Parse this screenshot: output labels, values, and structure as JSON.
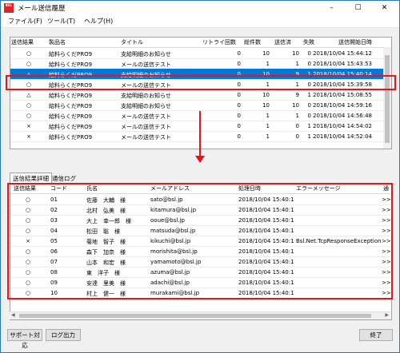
{
  "window": {
    "title": "メール送信履歴",
    "icon_text": "BSL"
  },
  "menu": [
    {
      "label": "ファイル(F)"
    },
    {
      "label": "ツール(T)"
    },
    {
      "label": "ヘルプ(H)"
    }
  ],
  "top_grid": {
    "columns": [
      "送信結果",
      "製品名",
      "タイトル",
      "リトライ回数",
      "総件数",
      "送信済",
      "失敗",
      "送信開始日時"
    ],
    "rows": [
      {
        "result": "○",
        "product": "給料らくだPRO9",
        "title": "支給明細のお知らせ",
        "retry": "0",
        "total": "10",
        "sent": "10",
        "fail": "0",
        "start": "2018/10/04 15:44:12"
      },
      {
        "result": "○",
        "product": "給料らくだPRO9",
        "title": "メールの送信テスト",
        "retry": "0",
        "total": "1",
        "sent": "1",
        "fail": "0",
        "start": "2018/10/04 15:43:53"
      },
      {
        "result": "△",
        "product": "給料らくだPRO9",
        "title": "支給明細のお知らせ",
        "retry": "0",
        "total": "10",
        "sent": "9",
        "fail": "1",
        "start": "2018/10/04 15:40:14",
        "selected": true
      },
      {
        "result": "○",
        "product": "給料らくだPRO9",
        "title": "メールの送信テスト",
        "retry": "0",
        "total": "1",
        "sent": "1",
        "fail": "0",
        "start": "2018/10/04 15:39:58"
      },
      {
        "result": "△",
        "product": "給料らくだPRO9",
        "title": "支給明細のお知らせ",
        "retry": "0",
        "total": "10",
        "sent": "9",
        "fail": "1",
        "start": "2018/10/04 15:08:55"
      },
      {
        "result": "○",
        "product": "給料らくだPRO9",
        "title": "支給明細のお知らせ",
        "retry": "0",
        "total": "10",
        "sent": "10",
        "fail": "0",
        "start": "2018/10/04 14:59:16"
      },
      {
        "result": "○",
        "product": "給料らくだPRO9",
        "title": "メールの送信テスト",
        "retry": "0",
        "total": "1",
        "sent": "1",
        "fail": "0",
        "start": "2018/10/04 14:56:48"
      },
      {
        "result": "×",
        "product": "給料らくだPRO9",
        "title": "メールの送信テスト",
        "retry": "0",
        "total": "1",
        "sent": "0",
        "fail": "1",
        "start": "2018/10/04 14:54:02"
      },
      {
        "result": "×",
        "product": "給料らくだPRO9",
        "title": "メールの送信テスト",
        "retry": "0",
        "total": "1",
        "sent": "0",
        "fail": "1",
        "start": "2018/10/04 14:52:04"
      }
    ]
  },
  "tabs": [
    {
      "label": "送信結果詳細",
      "active": true
    },
    {
      "label": "通信ログ",
      "active": false
    }
  ],
  "detail_grid": {
    "columns": [
      "送信結果",
      "コード",
      "氏名",
      "メールアドレス",
      "処理日時",
      "エラーメッセージ",
      "通"
    ],
    "rows": [
      {
        "result": "○",
        "code": "01",
        "name": "佐藤　大輔　様",
        "email": "sato@bsl.jp",
        "time": "2018/10/04 15:40:15",
        "error": "",
        "more": ">>"
      },
      {
        "result": "○",
        "code": "02",
        "name": "北村　弘美　様",
        "email": "kitamura@bsl.jp",
        "time": "2018/10/04 15:40:15",
        "error": "",
        "more": ">>"
      },
      {
        "result": "○",
        "code": "03",
        "name": "大上　幸一郎　様",
        "email": "ooue@bsl.jp",
        "time": "2018/10/04 15:40:16",
        "error": "",
        "more": ">>"
      },
      {
        "result": "○",
        "code": "04",
        "name": "松田　聡　様",
        "email": "matsuda@bsl.jp",
        "time": "2018/10/04 15:40:16",
        "error": "",
        "more": ">>"
      },
      {
        "result": "×",
        "code": "05",
        "name": "菊地　智子　様",
        "email": "kikuchi@bsl.jp",
        "time": "2018/10/04 15:40:16",
        "error": "Bsl.Net.TcpResponseException:",
        "more": ">>"
      },
      {
        "result": "○",
        "code": "06",
        "name": "森下　加奈　様",
        "email": "morishita@bsl.jp",
        "time": "2018/10/04 15:40:17",
        "error": "",
        "more": ">>"
      },
      {
        "result": "○",
        "code": "07",
        "name": "山本　和宏　様",
        "email": "yamamoto@bsl.jp",
        "time": "2018/10/04 15:40:17",
        "error": "",
        "more": ">>"
      },
      {
        "result": "○",
        "code": "08",
        "name": "東　洋子　様",
        "email": "azuma@bsl.jp",
        "time": "2018/10/04 15:40:18",
        "error": "",
        "more": ">>"
      },
      {
        "result": "○",
        "code": "09",
        "name": "安達　里美　様",
        "email": "adachi@bsl.jp",
        "time": "2018/10/04 15:40:18",
        "error": "",
        "more": ">>"
      },
      {
        "result": "○",
        "code": "10",
        "name": "村上　健一　様",
        "email": "murakami@bsl.jp",
        "time": "2018/10/04 15:40:19",
        "error": "",
        "more": ">>"
      }
    ]
  },
  "buttons": {
    "support": "サポート対応",
    "log_output": "ログ出力",
    "exit": "終了"
  },
  "annotation_color": "#e8131b",
  "selection_color": "#0078d7"
}
